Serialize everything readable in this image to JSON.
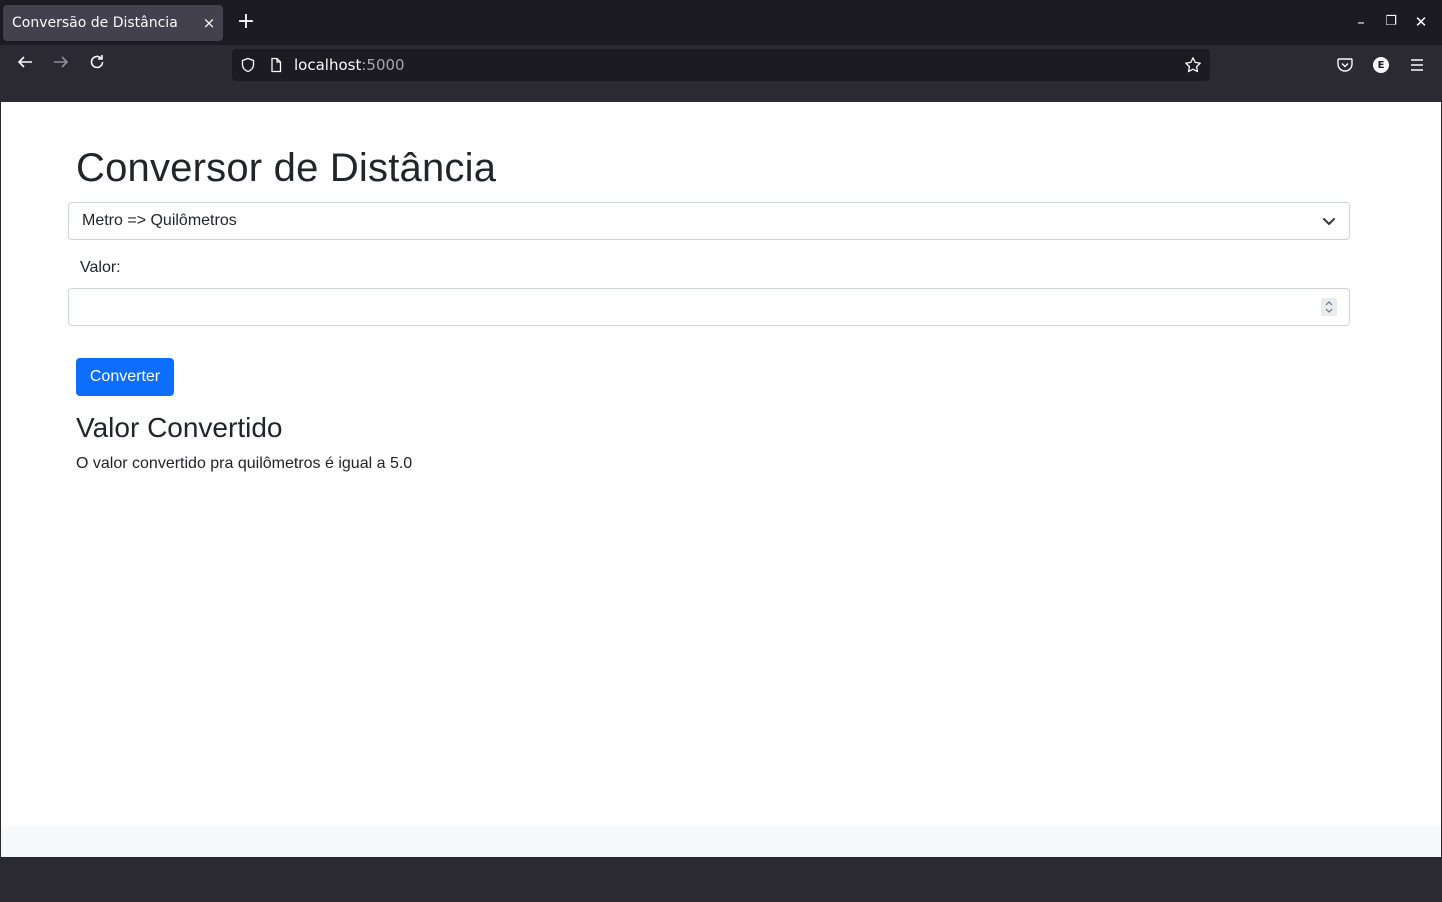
{
  "browser": {
    "tab_title": "Conversão de Distância",
    "tab_close": "×",
    "new_tab": "+",
    "url_host": "localhost",
    "url_port": ":5000",
    "profile_initial": "E",
    "window_controls": {
      "minimize": "–",
      "restore": "❐",
      "close": "✕"
    }
  },
  "page": {
    "title": "Conversor de Distância",
    "select_value": "Metro => Quilômetros",
    "value_label": "Valor:",
    "value_input": "",
    "convert_button": "Converter",
    "result_title": "Valor Convertido",
    "result_text": "O valor convertido pra quilômetros é igual a 5.0"
  },
  "colors": {
    "primary_button": "#0d6efd",
    "chrome_dark": "#1c1b22",
    "chrome_toolbar": "#2b2a33",
    "text": "#212529"
  }
}
